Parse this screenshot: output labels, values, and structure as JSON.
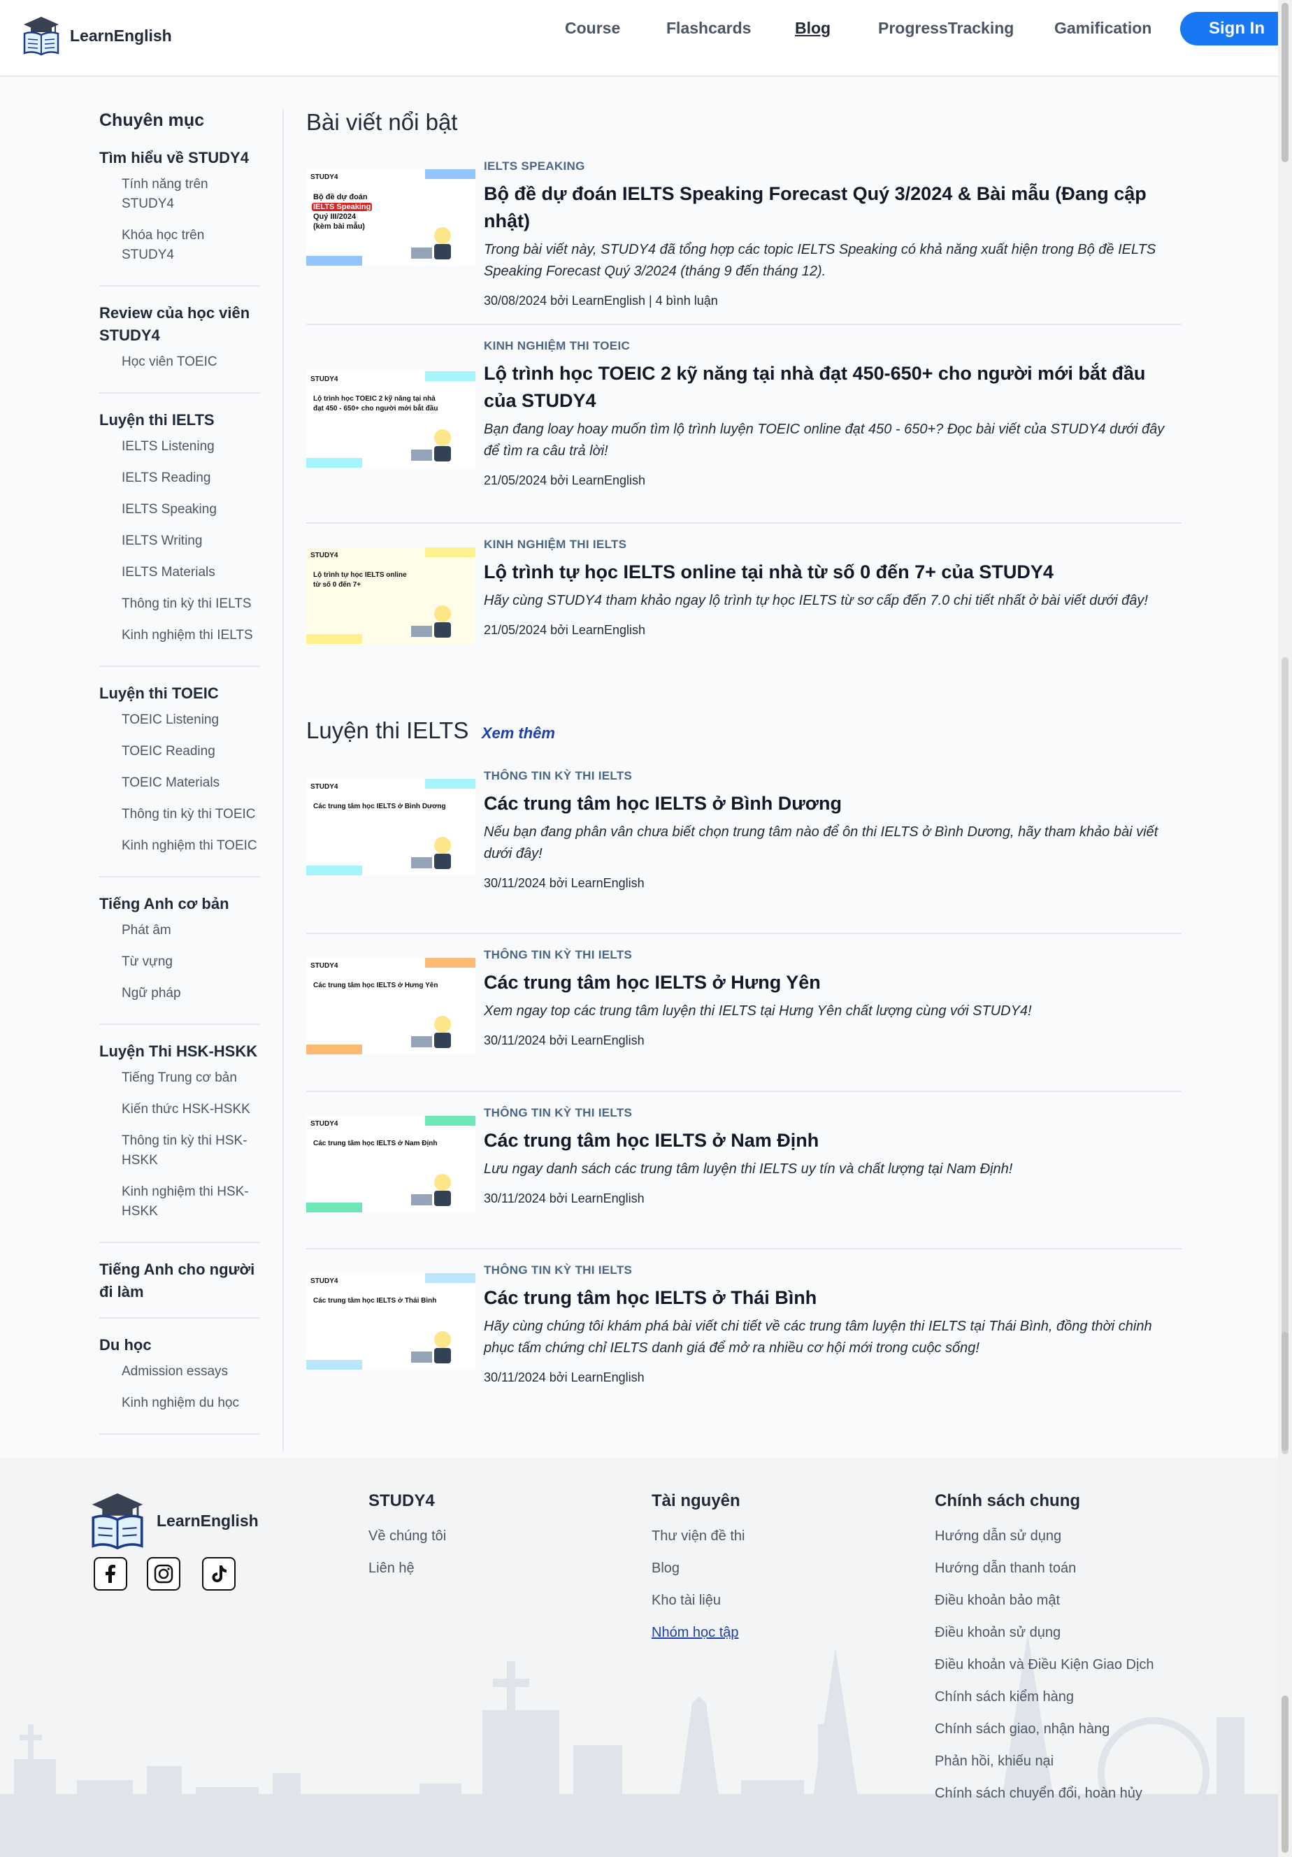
{
  "header": {
    "brand": "LearnEnglish",
    "nav": [
      "Course",
      "Flashcards",
      "Blog",
      "ProgressTracking",
      "Gamification"
    ],
    "active_nav": "Blog",
    "signin": "Sign In"
  },
  "sidebar": {
    "title": "Chuyên mục",
    "categories": [
      {
        "title": "Tìm hiểu về STUDY4",
        "items": [
          "Tính năng trên STUDY4",
          "Khóa học trên STUDY4"
        ]
      },
      {
        "title": "Review của học viên STUDY4",
        "items": [
          "Học viên TOEIC"
        ]
      },
      {
        "title": "Luyện thi IELTS",
        "items": [
          "IELTS Listening",
          "IELTS Reading",
          "IELTS Speaking",
          "IELTS Writing",
          "IELTS Materials",
          "Thông tin kỳ thi IELTS",
          "Kinh nghiệm thi IELTS"
        ]
      },
      {
        "title": "Luyện thi TOEIC",
        "items": [
          "TOEIC Listening",
          "TOEIC Reading",
          "TOEIC Materials",
          "Thông tin kỳ thi TOEIC",
          "Kinh nghiệm thi TOEIC"
        ]
      },
      {
        "title": "Tiếng Anh cơ bản",
        "items": [
          "Phát âm",
          "Từ vựng",
          "Ngữ pháp"
        ]
      },
      {
        "title": "Luyện Thi HSK-HSKK",
        "items": [
          "Tiếng Trung cơ bản",
          "Kiến thức HSK-HSKK",
          "Thông tin kỳ thi HSK-HSKK",
          "Kinh nghiệm thi HSK-HSKK"
        ]
      },
      {
        "title": "Tiếng Anh cho người đi làm",
        "items": []
      },
      {
        "title": "Du học",
        "items": [
          "Admission essays",
          "Kinh nghiệm du học"
        ]
      }
    ]
  },
  "featured": {
    "title": "Bài viết nổi bật",
    "posts": [
      {
        "category": "IELTS SPEAKING",
        "title": "Bộ đề dự đoán IELTS Speaking Forecast Quý 3/2024 & Bài mẫu (Đang cập nhật)",
        "desc": "Trong bài viết này, STUDY4 đã tổng hợp các topic IELTS Speaking có khả năng xuất hiện trong Bộ đề IELTS Speaking Forecast Quý 3/2024 (tháng 9 đến tháng 12).",
        "meta": "30/08/2024 bởi LearnEnglish | 4 bình luận",
        "thumb": {
          "brand": "STUDY4",
          "lines": [
            "Bộ đề dự đoán",
            "IELTS Speaking",
            "Quý III/2024",
            "(kèm bài mẫu)"
          ]
        }
      },
      {
        "category": "KINH NGHIỆM THI TOEIC",
        "title": "Lộ trình học TOEIC 2 kỹ năng tại nhà đạt 450-650+ cho người mới bắt đầu của STUDY4",
        "desc": "Bạn đang loay hoay muốn tìm lộ trình luyện TOEIC online đạt 450 - 650+? Đọc bài viết của STUDY4 dưới đây để tìm ra câu trả lời!",
        "meta": "21/05/2024 bởi LearnEnglish",
        "thumb": {
          "brand": "STUDY4",
          "lines": [
            "Lộ trình học TOEIC 2 kỹ năng tại nhà",
            "đạt 450 - 650+ cho người mới bắt đầu"
          ]
        }
      },
      {
        "category": "KINH NGHIỆM THI IELTS",
        "title": "Lộ trình tự học IELTS online tại nhà từ số 0 đến 7+ của STUDY4",
        "desc": "Hãy cùng STUDY4 tham khảo ngay lộ trình tự học IELTS từ sơ cấp đến 7.0 chi tiết nhất ở bài viết dưới đây!",
        "meta": "21/05/2024 bởi LearnEnglish",
        "thumb": {
          "brand": "STUDY4",
          "lines": [
            "Lộ trình tự học IELTS online",
            "từ số 0 đến 7+"
          ]
        }
      }
    ]
  },
  "ielts": {
    "title": "Luyện thi IELTS",
    "more": "Xem thêm",
    "posts": [
      {
        "category": "THÔNG TIN KỲ THI IELTS",
        "title": "Các trung tâm học IELTS ở Bình Dương",
        "desc": "Nếu bạn đang phân vân chưa biết chọn trung tâm nào để ôn thi IELTS ở Bình Dương, hãy tham khảo bài viết dưới đây!",
        "meta": "30/11/2024 bởi LearnEnglish",
        "thumb": {
          "brand": "STUDY4",
          "lines": [
            "Các trung tâm học IELTS ở Bình Dương"
          ]
        }
      },
      {
        "category": "THÔNG TIN KỲ THI IELTS",
        "title": "Các trung tâm học IELTS ở Hưng Yên",
        "desc": "Xem ngay top các trung tâm luyện thi IELTS tại Hưng Yên chất lượng cùng với STUDY4!",
        "meta": "30/11/2024 bởi LearnEnglish",
        "thumb": {
          "brand": "STUDY4",
          "lines": [
            "Các trung tâm học IELTS ở Hưng Yên"
          ]
        }
      },
      {
        "category": "THÔNG TIN KỲ THI IELTS",
        "title": "Các trung tâm học IELTS ở Nam Định",
        "desc": "Lưu ngay danh sách các trung tâm luyện thi IELTS uy tín và chất lượng tại Nam Định!",
        "meta": "30/11/2024 bởi LearnEnglish",
        "thumb": {
          "brand": "STUDY4",
          "lines": [
            "Các trung tâm học IELTS ở Nam Định"
          ]
        }
      },
      {
        "category": "THÔNG TIN KỲ THI IELTS",
        "title": "Các trung tâm học IELTS ở Thái Bình",
        "desc": "Hãy cùng chúng tôi khám phá bài viết chi tiết về các trung tâm luyện thi IELTS tại Thái Bình, đồng thời chinh phục tấm chứng chỉ IELTS danh giá để mở ra nhiều cơ hội mới trong cuộc sống!",
        "meta": "30/11/2024 bởi LearnEnglish",
        "thumb": {
          "brand": "STUDY4",
          "lines": [
            "Các trung tâm học IELTS ở Thái Bình"
          ]
        }
      }
    ]
  },
  "footer": {
    "brand": "LearnEnglish",
    "social": [
      "facebook-icon",
      "instagram-icon",
      "tiktok-icon"
    ],
    "columns": [
      {
        "title": "STUDY4",
        "items": [
          "Về chúng tôi",
          "Liên hệ"
        ]
      },
      {
        "title": "Tài nguyên",
        "items": [
          "Thư viện đề thi",
          "Blog",
          "Kho tài liệu",
          "Nhóm học tập"
        ]
      },
      {
        "title": "Chính sách chung",
        "items": [
          "Hướng dẫn sử dụng",
          "Hướng dẫn thanh toán",
          "Điều khoản bảo mật",
          "Điều khoản sử dụng",
          "Điều khoản và Điều Kiện Giao Dịch",
          "Chính sách kiểm hàng",
          "Chính sách giao, nhận hàng",
          "Phản hồi, khiếu nại",
          "Chính sách chuyển đổi, hoàn hủy"
        ]
      }
    ]
  },
  "colors": {
    "accent": "#1877f2",
    "link": "#1e40af",
    "category": "#4b6584"
  }
}
